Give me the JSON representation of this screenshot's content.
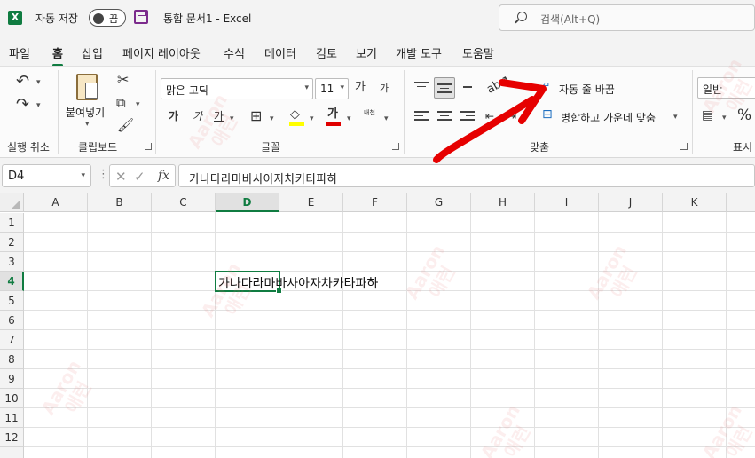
{
  "titlebar": {
    "app_icon": "excel-logo-icon",
    "app_letter": "X",
    "autosave_label": "자동 저장",
    "autosave_state": "끔",
    "doc_title": "통합 문서1  -  Excel",
    "search_placeholder": "검색(Alt+Q)"
  },
  "tabs": [
    "파일",
    "홈",
    "삽입",
    "페이지 레이아웃",
    "수식",
    "데이터",
    "검토",
    "보기",
    "개발 도구",
    "도움말"
  ],
  "active_tab": "홈",
  "ribbon": {
    "undo_group": {
      "label": "실행 취소"
    },
    "clipboard": {
      "label": "클립보드",
      "paste_label": "붙여넣기"
    },
    "font": {
      "label": "글꼴",
      "font_name": "맑은 고딕",
      "font_size": "11",
      "grow": "가",
      "shrink": "가",
      "bold": "가",
      "italic": "가",
      "underline": "가",
      "font_color": "가",
      "phonetic": "내천",
      "highlight_color": "#ffff00",
      "font_color_bar": "#e00000"
    },
    "alignment": {
      "label": "맞춤",
      "wrap_text": "자동 줄 바꿈",
      "merge_center": "병합하고 가운데 맞춤"
    },
    "number": {
      "label": "표시",
      "format": "일반",
      "percent": "%",
      "comma": ","
    }
  },
  "formula_bar": {
    "name_box": "D4",
    "value": "가나다라마바사아자차카타파하",
    "fx": "fx"
  },
  "grid": {
    "columns": [
      "A",
      "B",
      "C",
      "D",
      "E",
      "F",
      "G",
      "H",
      "I",
      "J",
      "K"
    ],
    "rows": [
      "1",
      "2",
      "3",
      "4",
      "5",
      "6",
      "7",
      "8",
      "9",
      "10",
      "11",
      "12"
    ],
    "selected_column": "D",
    "selected_row": "4",
    "cell_D4": "가나다라마바사아자차카타파하"
  },
  "watermark": {
    "line1": "Aaron",
    "line2": "애런"
  },
  "colors": {
    "excel_green": "#107c41",
    "annotation_red": "#e60000"
  }
}
